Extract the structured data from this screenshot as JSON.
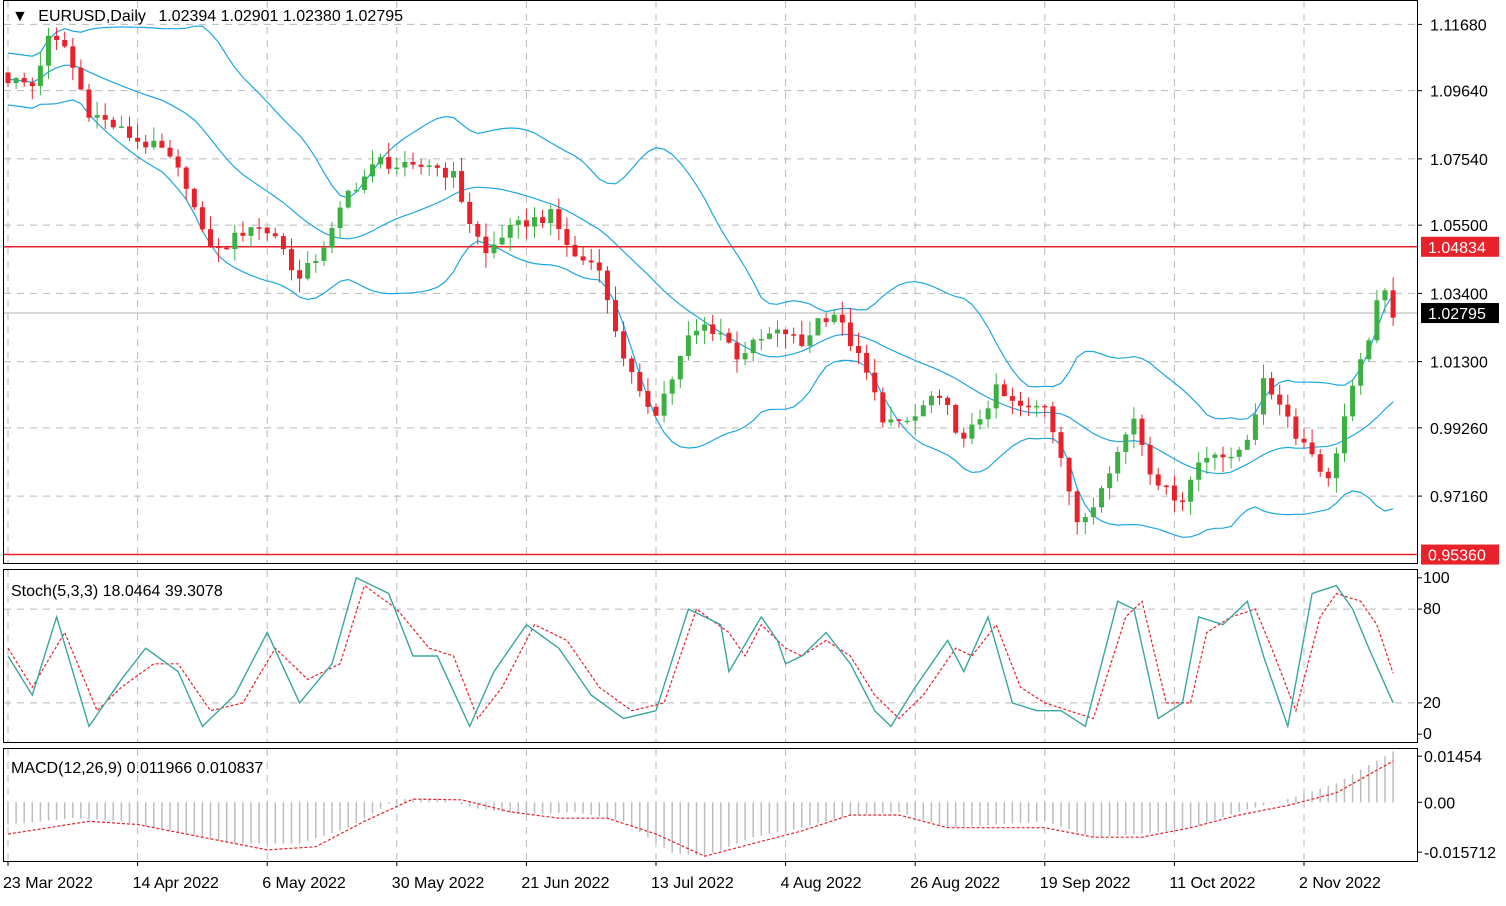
{
  "header": {
    "arrow": "▼",
    "symbol": "EURUSD,Daily",
    "ohlc": "1.02394 1.02901 1.02380 1.02795"
  },
  "stoch_title": "Stoch(5,3,3) 18.0464 39.3078",
  "macd_title": "MACD(12,26,9) 0.011966 0.010837",
  "colors": {
    "bull": "#3cb043",
    "bear": "#e8212b",
    "bands": "#1ea7e1",
    "hline": "#e8212b",
    "signal": "#e8212b",
    "stoch_main": "#3aa6a0",
    "stoch_signal": "#e8212b",
    "macd_hist": "#bdbdbd",
    "grid": "#b9b9b9",
    "price_tag": "#000000"
  },
  "chart_data": [
    {
      "type": "candlestick",
      "name": "EURUSD,Daily",
      "price_labels": [
        "1.11680",
        "1.09640",
        "1.07540",
        "1.05500",
        "1.03400",
        "1.01300",
        "0.99260",
        "0.97160"
      ],
      "price_label_values": [
        1.1168,
        1.0964,
        1.0754,
        1.055,
        1.034,
        1.013,
        0.9926,
        0.9716
      ],
      "hlines": [
        {
          "label": "1.04834",
          "value": 1.04834
        },
        {
          "label": "0.95360",
          "value": 0.9536
        }
      ],
      "current_price": {
        "label": "1.02795",
        "value": 1.02795
      },
      "ylim": [
        0.951,
        1.124
      ],
      "x_labels": [
        "23 Mar 2022",
        "14 Apr 2022",
        "6 May 2022",
        "30 May 2022",
        "21 Jun 2022",
        "13 Jul 2022",
        "4 Aug 2022",
        "26 Aug 2022",
        "19 Sep 2022",
        "11 Oct 2022",
        "2 Nov 2022"
      ],
      "x_label_bar_index": [
        0,
        16,
        32,
        48,
        64,
        80,
        96,
        112,
        128,
        144,
        160
      ],
      "bollinger_bands": true,
      "grid": true
    },
    {
      "type": "line",
      "name": "Stoch(5,3,3)",
      "levels": [
        "100",
        "80",
        "20",
        "0"
      ],
      "level_values": [
        100,
        80,
        20,
        0
      ],
      "ylim": [
        -5,
        105
      ],
      "last_main": 18.0464,
      "last_signal": 39.3078,
      "main_anchors": [
        [
          0,
          50
        ],
        [
          3,
          25
        ],
        [
          6,
          75
        ],
        [
          10,
          5
        ],
        [
          14,
          35
        ],
        [
          17,
          55
        ],
        [
          21,
          40
        ],
        [
          24,
          5
        ],
        [
          28,
          25
        ],
        [
          32,
          65
        ],
        [
          36,
          20
        ],
        [
          40,
          45
        ],
        [
          43,
          100
        ],
        [
          47,
          90
        ],
        [
          50,
          50
        ],
        [
          53,
          50
        ],
        [
          57,
          5
        ],
        [
          60,
          40
        ],
        [
          64,
          70
        ],
        [
          68,
          55
        ],
        [
          72,
          25
        ],
        [
          76,
          10
        ],
        [
          80,
          15
        ],
        [
          84,
          80
        ],
        [
          88,
          70
        ],
        [
          89,
          40
        ],
        [
          93,
          75
        ],
        [
          95,
          60
        ],
        [
          96,
          45
        ],
        [
          98,
          50
        ],
        [
          101,
          65
        ],
        [
          104,
          45
        ],
        [
          107,
          15
        ],
        [
          109,
          5
        ],
        [
          112,
          30
        ],
        [
          116,
          60
        ],
        [
          118,
          40
        ],
        [
          121,
          75
        ],
        [
          124,
          20
        ],
        [
          127,
          15
        ],
        [
          130,
          15
        ],
        [
          133,
          5
        ],
        [
          137,
          85
        ],
        [
          139,
          80
        ],
        [
          142,
          10
        ],
        [
          145,
          20
        ],
        [
          147,
          75
        ],
        [
          150,
          70
        ],
        [
          153,
          85
        ],
        [
          155,
          50
        ],
        [
          158,
          5
        ],
        [
          161,
          90
        ],
        [
          164,
          95
        ],
        [
          166,
          80
        ],
        [
          168,
          55
        ],
        [
          171,
          20
        ]
      ],
      "signal_anchors": [
        [
          0,
          55
        ],
        [
          3,
          30
        ],
        [
          7,
          65
        ],
        [
          11,
          15
        ],
        [
          14,
          30
        ],
        [
          18,
          45
        ],
        [
          21,
          45
        ],
        [
          25,
          15
        ],
        [
          29,
          20
        ],
        [
          33,
          55
        ],
        [
          37,
          35
        ],
        [
          41,
          45
        ],
        [
          44,
          95
        ],
        [
          48,
          80
        ],
        [
          52,
          55
        ],
        [
          55,
          50
        ],
        [
          58,
          10
        ],
        [
          61,
          30
        ],
        [
          65,
          70
        ],
        [
          69,
          60
        ],
        [
          73,
          30
        ],
        [
          77,
          15
        ],
        [
          81,
          20
        ],
        [
          85,
          80
        ],
        [
          89,
          65
        ],
        [
          91,
          50
        ],
        [
          93,
          70
        ],
        [
          96,
          55
        ],
        [
          98,
          50
        ],
        [
          101,
          60
        ],
        [
          104,
          50
        ],
        [
          107,
          25
        ],
        [
          110,
          10
        ],
        [
          113,
          25
        ],
        [
          117,
          55
        ],
        [
          119,
          50
        ],
        [
          122,
          70
        ],
        [
          125,
          30
        ],
        [
          128,
          20
        ],
        [
          131,
          15
        ],
        [
          134,
          10
        ],
        [
          138,
          75
        ],
        [
          140,
          85
        ],
        [
          143,
          20
        ],
        [
          146,
          20
        ],
        [
          148,
          65
        ],
        [
          151,
          75
        ],
        [
          154,
          80
        ],
        [
          156,
          55
        ],
        [
          159,
          15
        ],
        [
          162,
          75
        ],
        [
          164,
          90
        ],
        [
          167,
          85
        ],
        [
          169,
          70
        ],
        [
          171,
          39
        ]
      ]
    },
    {
      "type": "bar+line",
      "name": "MACD(12,26,9)",
      "levels": [
        "0.01454",
        "0.00",
        "-0.015712"
      ],
      "level_values": [
        0.01454,
        0.0,
        -0.015712
      ],
      "ylim": [
        -0.0185,
        0.0168
      ],
      "last_macd": 0.011966,
      "last_signal": 0.010837,
      "macd_anchors": [
        [
          0,
          -0.007
        ],
        [
          8,
          -0.005
        ],
        [
          14,
          -0.006
        ],
        [
          20,
          -0.009
        ],
        [
          28,
          -0.013
        ],
        [
          36,
          -0.013
        ],
        [
          42,
          -0.008
        ],
        [
          48,
          0.001
        ],
        [
          53,
          0.0012
        ],
        [
          58,
          -0.002
        ],
        [
          64,
          -0.004
        ],
        [
          70,
          -0.003
        ],
        [
          76,
          -0.006
        ],
        [
          82,
          -0.016
        ],
        [
          86,
          -0.017
        ],
        [
          92,
          -0.011
        ],
        [
          98,
          -0.008
        ],
        [
          104,
          -0.004
        ],
        [
          110,
          -0.003
        ],
        [
          116,
          -0.008
        ],
        [
          122,
          -0.007
        ],
        [
          128,
          -0.006
        ],
        [
          134,
          -0.011
        ],
        [
          140,
          -0.01
        ],
        [
          146,
          -0.008
        ],
        [
          152,
          -0.003
        ],
        [
          158,
          0.001
        ],
        [
          164,
          0.006
        ],
        [
          171,
          0.016
        ]
      ],
      "signal_anchors": [
        [
          0,
          -0.01
        ],
        [
          10,
          -0.006
        ],
        [
          16,
          -0.007
        ],
        [
          24,
          -0.011
        ],
        [
          32,
          -0.015
        ],
        [
          38,
          -0.014
        ],
        [
          44,
          -0.006
        ],
        [
          50,
          0.001
        ],
        [
          56,
          0.0008
        ],
        [
          62,
          -0.003
        ],
        [
          68,
          -0.005
        ],
        [
          74,
          -0.005
        ],
        [
          80,
          -0.01
        ],
        [
          86,
          -0.017
        ],
        [
          92,
          -0.013
        ],
        [
          98,
          -0.009
        ],
        [
          104,
          -0.004
        ],
        [
          110,
          -0.004
        ],
        [
          116,
          -0.008
        ],
        [
          122,
          -0.008
        ],
        [
          128,
          -0.008
        ],
        [
          134,
          -0.011
        ],
        [
          140,
          -0.011
        ],
        [
          146,
          -0.008
        ],
        [
          152,
          -0.004
        ],
        [
          158,
          -0.001
        ],
        [
          164,
          0.003
        ],
        [
          171,
          0.013
        ]
      ]
    }
  ]
}
